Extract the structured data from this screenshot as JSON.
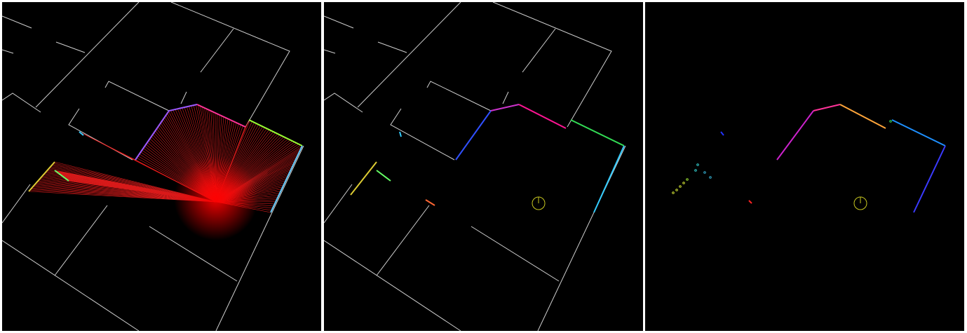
{
  "panels": [
    {
      "id": "scan-rays-view",
      "rays_shown": true,
      "robot_marker_shown": false
    },
    {
      "id": "scan-segments-on-map-view",
      "rays_shown": false,
      "robot_marker_shown": true
    },
    {
      "id": "scan-segments-only-view",
      "rays_shown": false,
      "robot_marker_shown": true
    }
  ],
  "colors": {
    "background": "#000000",
    "separator": "#ffffff",
    "map_wall": "#cfcfcf",
    "ray": "#ff2020",
    "robot_marker": "#c8c820"
  },
  "segment_palette": [
    "#ff1493",
    "#ff3399",
    "#cc33cc",
    "#7a3cff",
    "#3050ff",
    "#1e90ff",
    "#33ccff",
    "#66ff66",
    "#adff2f",
    "#ffd700",
    "#ffa500",
    "#ff4040"
  ]
}
